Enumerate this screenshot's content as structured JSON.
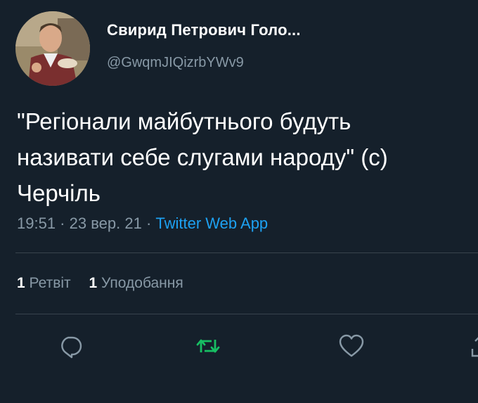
{
  "user": {
    "display_name": "Свирид Петрович Голо...",
    "handle": "@GwqmJIQizrbYWv9"
  },
  "tweet": {
    "text": "\"Регіонали майбутнього будуть\nназивати себе слугами народу\" (с)\nЧерчіль"
  },
  "meta": {
    "time": "19:51",
    "separator1": " · ",
    "date": "23 вер. 21",
    "separator2": " · ",
    "source": "Twitter Web App"
  },
  "stats": {
    "retweets_count": "1",
    "retweets_label": "Ретвіт",
    "likes_count": "1",
    "likes_label": "Уподобання"
  },
  "actions": {
    "reply_icon": "reply-icon",
    "retweet_icon": "retweet-icon",
    "like_icon": "heart-icon",
    "share_icon": "share-icon"
  },
  "colors": {
    "background": "#15202b",
    "secondary_text": "#8899a6",
    "accent": "#1da1f2",
    "retweet_green": "#17bf63",
    "divider": "#38444d"
  }
}
